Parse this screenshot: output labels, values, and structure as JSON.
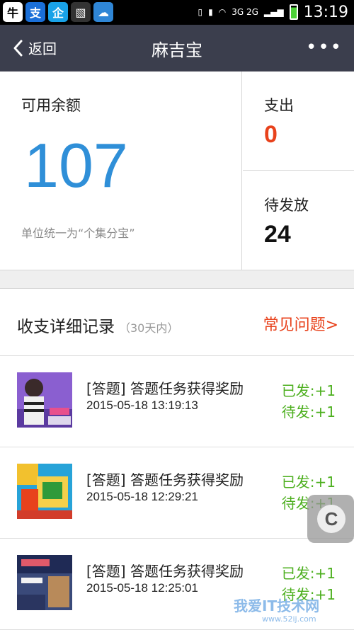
{
  "status_bar": {
    "apps": [
      {
        "name": "niu-app-icon",
        "glyph": "牛",
        "bg": "#ffffff",
        "fg": "#000000"
      },
      {
        "name": "alipay-app-icon",
        "glyph": "支",
        "bg": "#1a6fd8",
        "fg": "#ffffff"
      },
      {
        "name": "qq-app-icon",
        "glyph": "企",
        "bg": "#19a2e8",
        "fg": "#ffffff"
      },
      {
        "name": "gallery-app-icon",
        "glyph": "▧",
        "bg": "#333333",
        "fg": "#ffffff"
      },
      {
        "name": "weather-app-icon",
        "glyph": "☁",
        "bg": "#2f86d6",
        "fg": "#ffffff"
      }
    ],
    "network": "3G 2G",
    "time": "13:19"
  },
  "nav": {
    "back_label": "返回",
    "title": "麻吉宝",
    "more_label": "•••"
  },
  "summary": {
    "balance_label": "可用余额",
    "balance_value": "107",
    "balance_note": "单位统一为“个集分宝”",
    "spend_label": "支出",
    "spend_value": "0",
    "pending_label": "待发放",
    "pending_value": "24"
  },
  "records": {
    "title": "收支详细记录",
    "subtitle": "（30天内）",
    "faq_label": "常见问题>",
    "items": [
      {
        "title": "[答题] 答题任务获得奖励",
        "time": "2015-05-18 13:19:13",
        "issued": "已发:+1",
        "pending": "待发:+1"
      },
      {
        "title": "[答题] 答题任务获得奖励",
        "time": "2015-05-18 12:29:21",
        "issued": "已发:+1",
        "pending": "待发:+1"
      },
      {
        "title": "[答题] 答题任务获得奖励",
        "time": "2015-05-18 12:25:01",
        "issued": "已发:+1",
        "pending": "待发:+1"
      }
    ]
  },
  "colors": {
    "nav_bg": "#3b3e4d",
    "balance_blue": "#2f8fd8",
    "accent_red": "#e8421c",
    "issued_green": "#4caf1e"
  },
  "watermark": {
    "text": "我爱IT技术网",
    "url": "www.52ij.com"
  }
}
